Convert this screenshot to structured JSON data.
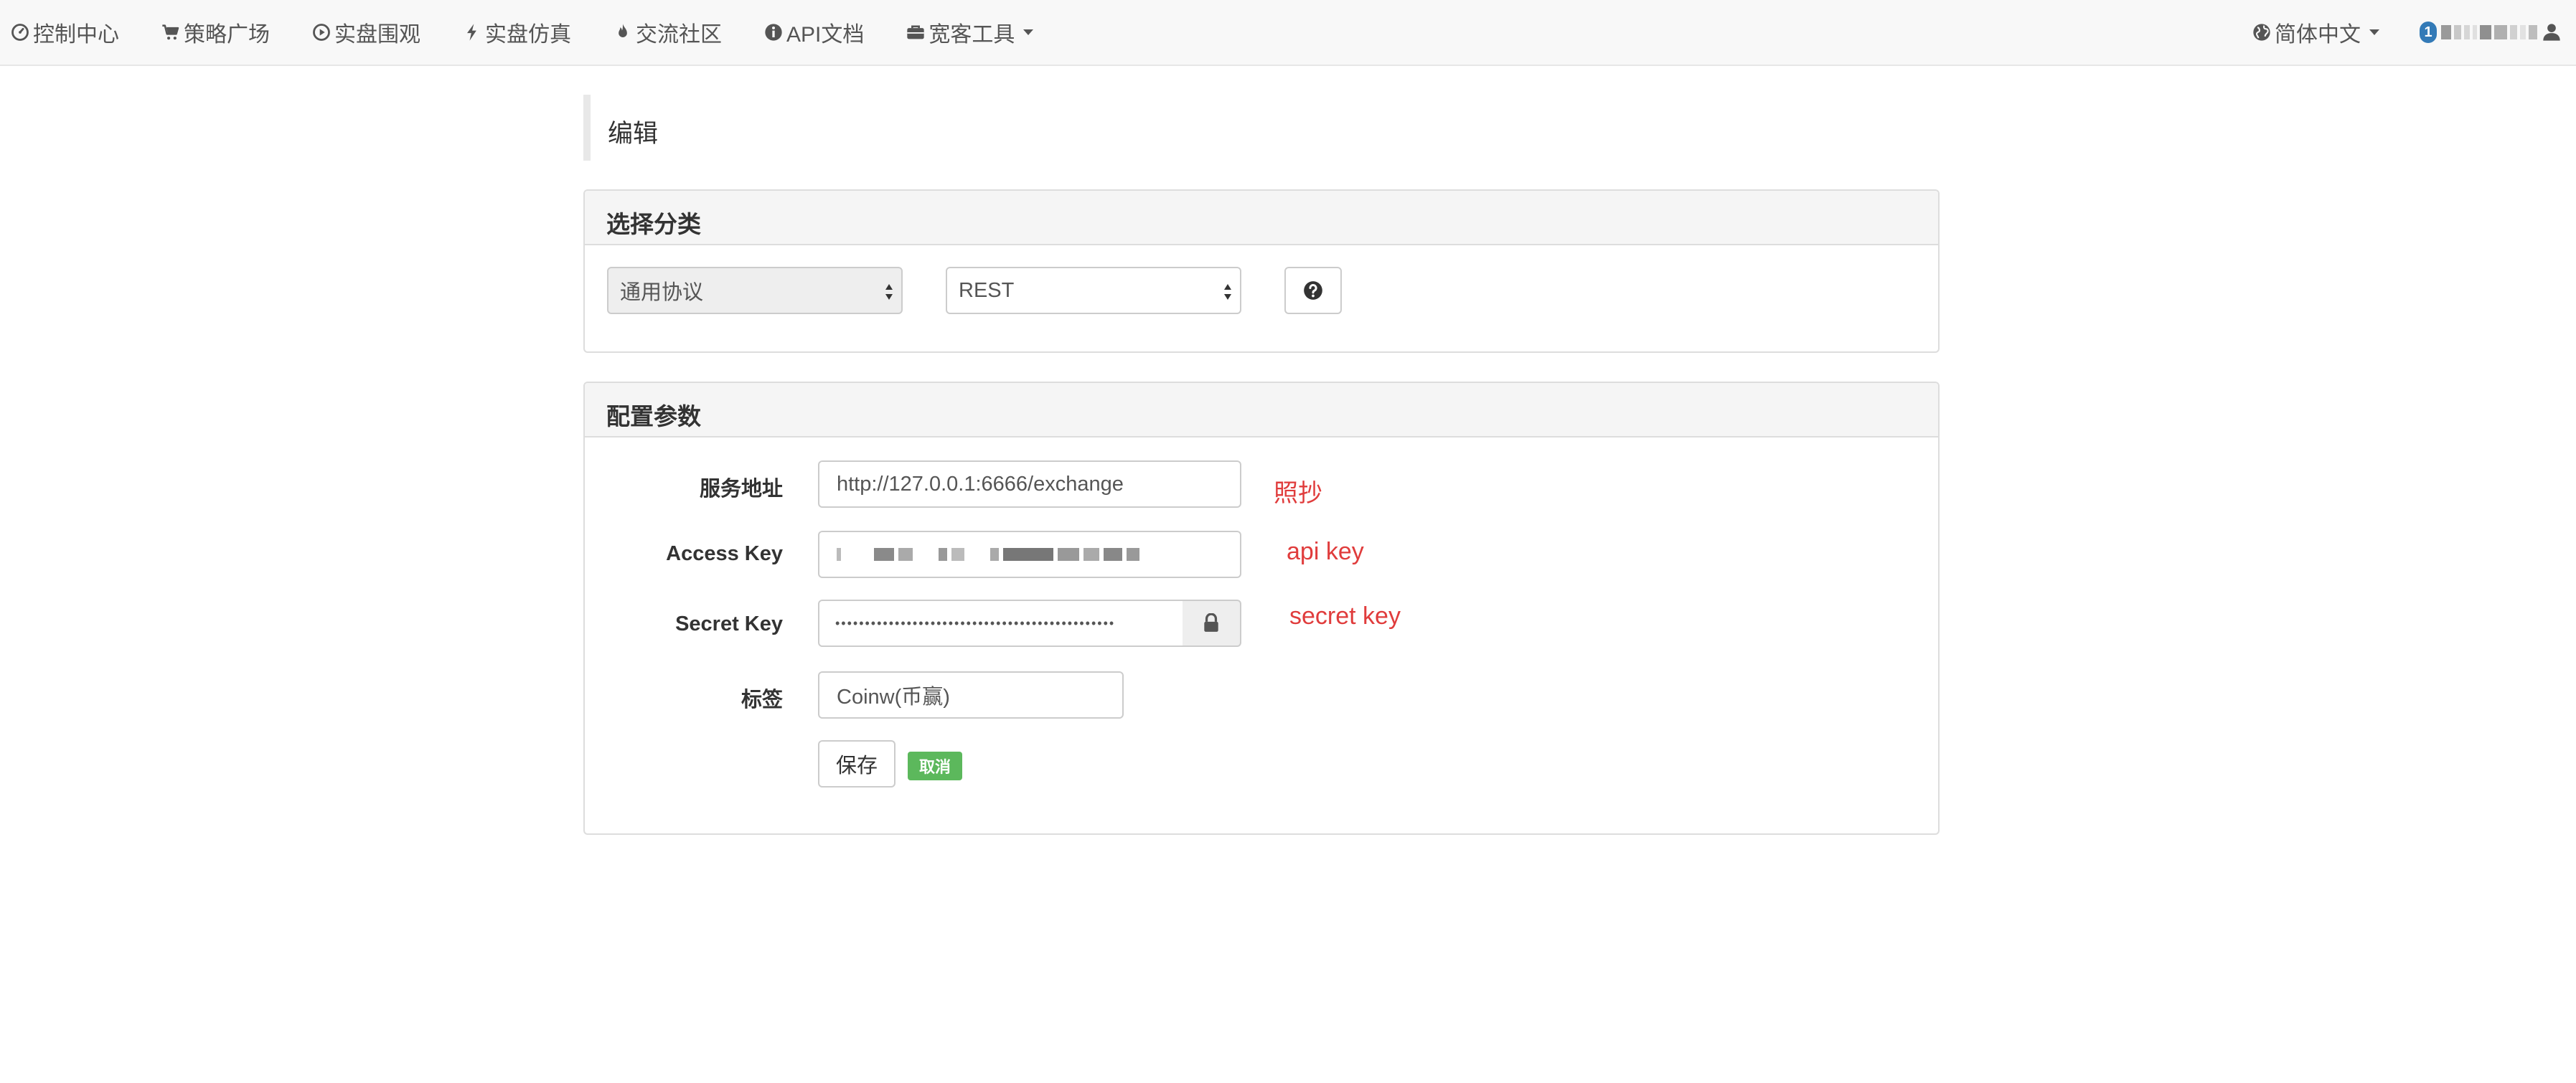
{
  "nav": {
    "items": [
      {
        "label": "控制中心",
        "icon": "dashboard-icon"
      },
      {
        "label": "策略广场",
        "icon": "cart-icon"
      },
      {
        "label": "实盘围观",
        "icon": "play-circle-icon"
      },
      {
        "label": "实盘仿真",
        "icon": "bolt-icon"
      },
      {
        "label": "交流社区",
        "icon": "fire-icon"
      },
      {
        "label": "API文档",
        "icon": "info-circle-icon"
      },
      {
        "label": "宽客工具",
        "icon": "briefcase-icon"
      }
    ],
    "language": "简体中文",
    "badge": "1",
    "user_icon": "user-icon"
  },
  "page": {
    "title": "编辑"
  },
  "category_panel": {
    "title": "选择分类",
    "protocol_select": "通用协议",
    "type_select": "REST",
    "help_icon": "question-circle-icon"
  },
  "config_panel": {
    "title": "配置参数",
    "fields": {
      "service_address": {
        "label": "服务地址",
        "value": "http://127.0.0.1:6666/exchange"
      },
      "access_key": {
        "label": "Access Key"
      },
      "secret_key": {
        "label": "Secret Key",
        "value": "•••••••••••••••••••••••••••••••••••••••••••••••"
      },
      "tag": {
        "label": "标签",
        "value": "Coinw(币赢)"
      }
    },
    "save_label": "保存",
    "cancel_label": "取消"
  },
  "annotations": {
    "service_note": "照抄",
    "access_note": "api key",
    "secret_note": "secret key"
  }
}
